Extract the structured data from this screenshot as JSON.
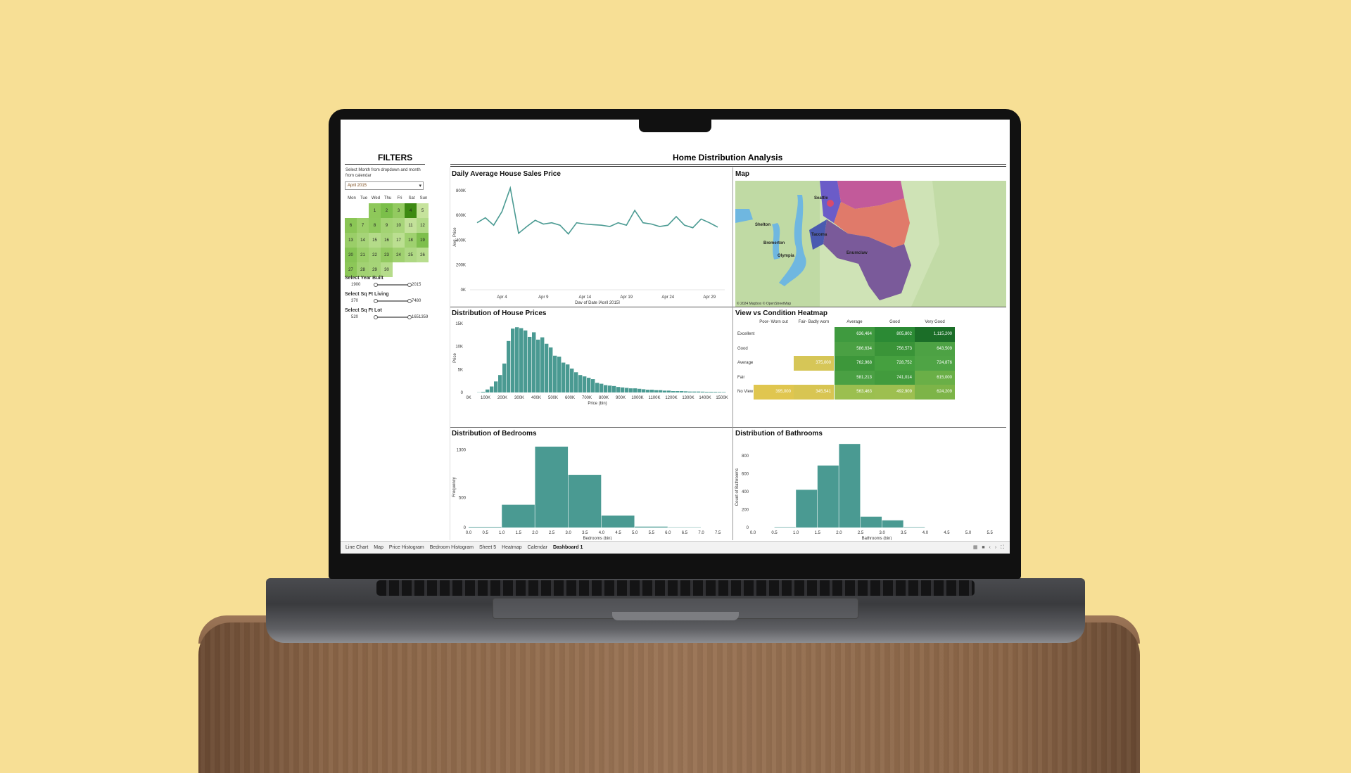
{
  "filters": {
    "title": "FILTERS",
    "hint": "Select Month from dropdown and month from calendar",
    "month_value": "April 2015",
    "weekdays": [
      "Mon",
      "Tue",
      "Wed",
      "Thu",
      "Fri",
      "Sat",
      "Sun"
    ],
    "calendar_days": [
      {
        "day": "1",
        "col": 2,
        "row": 0,
        "shade": "#8ec85a"
      },
      {
        "day": "2",
        "col": 3,
        "row": 0,
        "shade": "#7bbf4a"
      },
      {
        "day": "3",
        "col": 4,
        "row": 0,
        "shade": "#93ca60"
      },
      {
        "day": "4",
        "col": 5,
        "row": 0,
        "shade": "#3d8a12"
      },
      {
        "day": "5",
        "col": 6,
        "row": 0,
        "shade": "#c6e39c"
      },
      {
        "day": "6",
        "col": 0,
        "row": 1,
        "shade": "#8ac655"
      },
      {
        "day": "7",
        "col": 1,
        "row": 1,
        "shade": "#9ccf69"
      },
      {
        "day": "8",
        "col": 2,
        "row": 1,
        "shade": "#8fc95c"
      },
      {
        "day": "9",
        "col": 3,
        "row": 1,
        "shade": "#a3d373"
      },
      {
        "day": "10",
        "col": 4,
        "row": 1,
        "shade": "#a8d57a"
      },
      {
        "day": "11",
        "col": 5,
        "row": 1,
        "shade": "#c3e19a"
      },
      {
        "day": "12",
        "col": 6,
        "row": 1,
        "shade": "#b2da87"
      },
      {
        "day": "13",
        "col": 0,
        "row": 2,
        "shade": "#9ace68"
      },
      {
        "day": "14",
        "col": 1,
        "row": 2,
        "shade": "#a6d478"
      },
      {
        "day": "15",
        "col": 2,
        "row": 2,
        "shade": "#b4db89"
      },
      {
        "day": "16",
        "col": 3,
        "row": 2,
        "shade": "#a9d57c"
      },
      {
        "day": "17",
        "col": 4,
        "row": 2,
        "shade": "#bbdf91"
      },
      {
        "day": "18",
        "col": 5,
        "row": 2,
        "shade": "#9fd16f"
      },
      {
        "day": "19",
        "col": 6,
        "row": 2,
        "shade": "#7ebf4d"
      },
      {
        "day": "20",
        "col": 0,
        "row": 3,
        "shade": "#86c453"
      },
      {
        "day": "21",
        "col": 1,
        "row": 3,
        "shade": "#9ace68"
      },
      {
        "day": "22",
        "col": 2,
        "row": 3,
        "shade": "#a4d376"
      },
      {
        "day": "23",
        "col": 3,
        "row": 3,
        "shade": "#93ca60"
      },
      {
        "day": "24",
        "col": 4,
        "row": 3,
        "shade": "#a0d170"
      },
      {
        "day": "25",
        "col": 5,
        "row": 3,
        "shade": "#aed883"
      },
      {
        "day": "26",
        "col": 6,
        "row": 3,
        "shade": "#b8dd8e"
      },
      {
        "day": "27",
        "col": 0,
        "row": 4,
        "shade": "#8cc758"
      },
      {
        "day": "28",
        "col": 1,
        "row": 4,
        "shade": "#a2d273"
      },
      {
        "day": "29",
        "col": 2,
        "row": 4,
        "shade": "#a6d478"
      },
      {
        "day": "30",
        "col": 3,
        "row": 4,
        "shade": "#b6dc8b"
      }
    ],
    "sliders": [
      {
        "label": "Select Year Built",
        "min": "1900",
        "max": "2015"
      },
      {
        "label": "Select Sq Ft Living",
        "min": "370",
        "max": "7480"
      },
      {
        "label": "Select Sq Ft Lot",
        "min": "520",
        "max": "1651359"
      }
    ]
  },
  "dashboard": {
    "title": "Home Distribution Analysis"
  },
  "line_panel": {
    "title": "Daily Average House Sales Price",
    "xlabel": "Day of Date [April 2015]",
    "ylabel": "Avg. Price",
    "xticks": [
      "Apr 4",
      "Apr 9",
      "Apr 14",
      "Apr 19",
      "Apr 24",
      "Apr 29"
    ],
    "yticks": [
      "800K",
      "600K",
      "400K",
      "200K",
      "0K"
    ]
  },
  "map_panel": {
    "title": "Map",
    "attribution": "© 2024 Mapbox © OpenStreetMap",
    "place_labels": [
      "Seattle",
      "Tacoma",
      "Olympia",
      "Enumclaw",
      "Shelton",
      "Bremerton"
    ]
  },
  "price_hist_panel": {
    "title": "Distribution of House Prices",
    "xlabel": "Price (bin)",
    "ylabel": "Price",
    "xticks": [
      "0K",
      "100K",
      "200K",
      "300K",
      "400K",
      "500K",
      "600K",
      "700K",
      "800K",
      "900K",
      "1000K",
      "1100K",
      "1200K",
      "1300K",
      "1400K",
      "1500K"
    ],
    "yticks": [
      "15K",
      "10K",
      "5K",
      "0"
    ]
  },
  "heatmap_panel": {
    "title": "View vs Condition Heatmap",
    "columns": [
      "Poor- Worn out",
      "Fair- Badly worn",
      "Average",
      "Good",
      "Very Good"
    ],
    "rows": [
      "Excellent",
      "Good",
      "Average",
      "Fair",
      "No View"
    ],
    "cells": [
      {
        "row": 0,
        "col": 2,
        "value": "636,464",
        "color": "#3f9a3f"
      },
      {
        "row": 0,
        "col": 3,
        "value": "805,802",
        "color": "#2b8a34"
      },
      {
        "row": 0,
        "col": 4,
        "value": "1,115,200",
        "color": "#1b6e28"
      },
      {
        "row": 1,
        "col": 2,
        "value": "586,634",
        "color": "#4aa043"
      },
      {
        "row": 1,
        "col": 3,
        "value": "756,573",
        "color": "#3a9438"
      },
      {
        "row": 1,
        "col": 4,
        "value": "643,509",
        "color": "#4da244"
      },
      {
        "row": 2,
        "col": 1,
        "value": "375,000",
        "color": "#d6c657"
      },
      {
        "row": 2,
        "col": 2,
        "value": "762,968",
        "color": "#3d973a"
      },
      {
        "row": 2,
        "col": 3,
        "value": "728,752",
        "color": "#45a03f"
      },
      {
        "row": 2,
        "col": 4,
        "value": "724,876",
        "color": "#4fa445"
      },
      {
        "row": 3,
        "col": 2,
        "value": "581,213",
        "color": "#4aa043"
      },
      {
        "row": 3,
        "col": 3,
        "value": "741,014",
        "color": "#429b3d"
      },
      {
        "row": 3,
        "col": 4,
        "value": "615,000",
        "color": "#6aaf47"
      },
      {
        "row": 4,
        "col": 0,
        "value": "395,000",
        "color": "#e0c64f"
      },
      {
        "row": 4,
        "col": 1,
        "value": "345,541",
        "color": "#d8c552"
      },
      {
        "row": 4,
        "col": 2,
        "value": "563,463",
        "color": "#9bbf4f"
      },
      {
        "row": 4,
        "col": 3,
        "value": "492,909",
        "color": "#9dbf50"
      },
      {
        "row": 4,
        "col": 4,
        "value": "624,209",
        "color": "#7db448"
      }
    ]
  },
  "bedroom_panel": {
    "title": "Distribution of Bedrooms",
    "xlabel": "Bedrooms (bin)",
    "ylabel": "Frequency",
    "xticks": [
      "0.0",
      "0.5",
      "1.0",
      "1.5",
      "2.0",
      "2.5",
      "3.0",
      "3.5",
      "4.0",
      "4.5",
      "5.0",
      "5.5",
      "6.0",
      "6.5",
      "7.0",
      "7.5"
    ],
    "yticks": [
      "1300",
      "500",
      "0"
    ]
  },
  "bathroom_panel": {
    "title": "Distribution of Bathrooms",
    "xlabel": "Bathrooms (bin)",
    "ylabel": "Count of Bathrooms",
    "xticks": [
      "0.0",
      "0.5",
      "1.0",
      "1.5",
      "2.0",
      "2.5",
      "3.0",
      "3.5",
      "4.0",
      "4.5",
      "5.0",
      "5.5"
    ],
    "yticks": [
      "800",
      "600",
      "400",
      "200",
      "0"
    ]
  },
  "tabs": [
    "Line Chart",
    "Map",
    "Price Histogram",
    "Bedroom Histogram",
    "Sheet 5",
    "Heatmap",
    "Calendar",
    "Dashboard 1"
  ],
  "active_tab": 7,
  "colors": {
    "teal": "#4a9a92",
    "accent_green": "#3d8a12"
  },
  "chart_data": [
    {
      "type": "line",
      "title": "Daily Average House Sales Price",
      "xlabel": "Day of Date [April 2015]",
      "ylabel": "Avg. Price",
      "x": [
        "Apr 1",
        "Apr 2",
        "Apr 3",
        "Apr 4",
        "Apr 5",
        "Apr 6",
        "Apr 7",
        "Apr 8",
        "Apr 9",
        "Apr 10",
        "Apr 11",
        "Apr 12",
        "Apr 13",
        "Apr 14",
        "Apr 15",
        "Apr 16",
        "Apr 17",
        "Apr 18",
        "Apr 19",
        "Apr 20",
        "Apr 21",
        "Apr 22",
        "Apr 23",
        "Apr 24",
        "Apr 25",
        "Apr 26",
        "Apr 27",
        "Apr 28",
        "Apr 29",
        "Apr 30"
      ],
      "values": [
        540000,
        580000,
        520000,
        630000,
        820000,
        455000,
        510000,
        560000,
        530000,
        540000,
        520000,
        450000,
        540000,
        530000,
        525000,
        520000,
        510000,
        540000,
        520000,
        640000,
        540000,
        530000,
        510000,
        520000,
        590000,
        520000,
        500000,
        570000,
        540000,
        505000
      ],
      "ylim": [
        0,
        850000
      ]
    },
    {
      "type": "bar",
      "title": "Distribution of House Prices",
      "xlabel": "Price (bin)",
      "ylabel": "Price",
      "bin_start_k": [
        50,
        75,
        100,
        125,
        150,
        175,
        200,
        225,
        250,
        275,
        300,
        325,
        350,
        375,
        400,
        425,
        450,
        475,
        500,
        525,
        550,
        575,
        600,
        625,
        650,
        675,
        700,
        725,
        750,
        775,
        800,
        825,
        850,
        875,
        900,
        925,
        950,
        975,
        1000,
        1025,
        1050,
        1075,
        1100,
        1125,
        1150,
        1175,
        1200,
        1225,
        1250,
        1275,
        1300,
        1325,
        1350,
        1375,
        1400,
        1425,
        1450,
        1475,
        1500
      ],
      "values": [
        50,
        150,
        650,
        1300,
        2400,
        3800,
        6300,
        11200,
        13900,
        14200,
        14000,
        13500,
        12100,
        13100,
        11500,
        12000,
        10600,
        9800,
        8000,
        7800,
        6500,
        6100,
        5200,
        4400,
        3800,
        3500,
        3200,
        2900,
        2100,
        1900,
        1600,
        1500,
        1400,
        1200,
        1100,
        1000,
        900,
        900,
        800,
        700,
        600,
        600,
        500,
        500,
        400,
        400,
        300,
        300,
        300,
        250,
        200,
        200,
        200,
        180,
        150,
        150,
        140,
        120,
        100
      ],
      "ylim": [
        0,
        15000
      ]
    },
    {
      "type": "bar",
      "title": "Distribution of Bedrooms",
      "xlabel": "Bedrooms (bin)",
      "ylabel": "Frequency",
      "bin_start": [
        0,
        1,
        2,
        3,
        4,
        5,
        6
      ],
      "values": [
        10,
        380,
        1350,
        880,
        200,
        15,
        5
      ],
      "ylim": [
        0,
        1350
      ]
    },
    {
      "type": "bar",
      "title": "Distribution of Bathrooms",
      "xlabel": "Bathrooms (bin)",
      "ylabel": "Count of Bathrooms",
      "bin_start": [
        0.5,
        1.0,
        1.5,
        2.0,
        2.5,
        3.0,
        3.5,
        4.0
      ],
      "values": [
        5,
        420,
        690,
        930,
        120,
        80,
        5,
        0
      ],
      "ylim": [
        0,
        900
      ]
    },
    {
      "type": "heatmap",
      "title": "View vs Condition Heatmap",
      "x": [
        "Poor- Worn out",
        "Fair- Badly worn",
        "Average",
        "Good",
        "Very Good"
      ],
      "y": [
        "Excellent",
        "Good",
        "Average",
        "Fair",
        "No View"
      ],
      "values": [
        [
          null,
          null,
          636464,
          805802,
          1115200
        ],
        [
          null,
          null,
          586634,
          756573,
          643509
        ],
        [
          null,
          375000,
          762968,
          728752,
          724876
        ],
        [
          null,
          null,
          581213,
          741014,
          615000
        ],
        [
          395000,
          345541,
          563463,
          492909,
          624209
        ]
      ]
    }
  ]
}
